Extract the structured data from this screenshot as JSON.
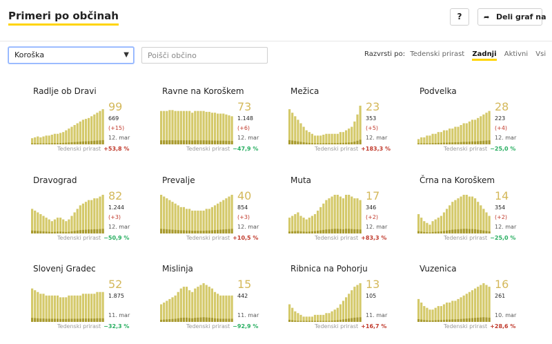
{
  "header": {
    "title": "Primeri po občinah",
    "help_label": "?",
    "share_label": "Deli graf na"
  },
  "filters": {
    "region": "Koroška",
    "search_placeholder": "Poišči občino",
    "sort_label": "Razvrsti po:",
    "sort_options": [
      "Tedenski prirast",
      "Zadnji",
      "Aktivni",
      "Vsi"
    ],
    "sort_active": "Zadnji"
  },
  "colors": {
    "accent": "#ffd400",
    "bar": "#d4c96a",
    "bar_dark": "#a89a2e",
    "positive_change": "#c0392b",
    "negative_change": "#27ae60"
  },
  "weekly_label": "Tedenski prirast",
  "cards": [
    {
      "name": "Radlje ob Dravi",
      "big": "99",
      "count": "669",
      "change": "(+15)",
      "date": "12. mar",
      "pct": "+53,8 %",
      "trend": "pos",
      "bars": [
        7,
        8,
        9,
        8,
        9,
        10,
        10,
        11,
        12,
        12,
        13,
        14,
        16,
        18,
        20,
        22,
        24,
        26,
        28,
        29,
        30,
        32,
        34,
        36,
        38,
        40
      ]
    },
    {
      "name": "Ravne na Koroškem",
      "big": "73",
      "count": "1.148",
      "change": "(+6)",
      "date": "12. mar",
      "pct": "−47,9 %",
      "trend": "neg",
      "bars": [
        38,
        38,
        38,
        39,
        39,
        38,
        38,
        38,
        38,
        38,
        38,
        36,
        38,
        38,
        38,
        38,
        37,
        37,
        36,
        36,
        35,
        35,
        35,
        34,
        33,
        32
      ]
    },
    {
      "name": "Mežica",
      "big": "23",
      "count": "353",
      "change": "(+5)",
      "date": "12. mar",
      "pct": "+183,3 %",
      "trend": "pos",
      "bars": [
        40,
        36,
        32,
        28,
        24,
        20,
        16,
        14,
        12,
        10,
        10,
        10,
        11,
        12,
        12,
        12,
        12,
        12,
        14,
        14,
        16,
        18,
        20,
        26,
        34,
        44
      ]
    },
    {
      "name": "Podvelka",
      "big": "28",
      "count": "223",
      "change": "(+4)",
      "date": "12. mar",
      "pct": "−25,0 %",
      "trend": "neg",
      "bars": [
        6,
        8,
        8,
        10,
        10,
        12,
        12,
        14,
        14,
        16,
        16,
        18,
        18,
        20,
        20,
        22,
        24,
        24,
        26,
        28,
        28,
        30,
        32,
        34,
        36,
        38
      ]
    },
    {
      "name": "Dravograd",
      "big": "82",
      "count": "1.244",
      "change": "(+3)",
      "date": "12. mar",
      "pct": "−50,9 %",
      "trend": "neg",
      "bars": [
        28,
        26,
        24,
        22,
        20,
        18,
        16,
        14,
        16,
        18,
        18,
        16,
        14,
        16,
        20,
        24,
        28,
        32,
        34,
        36,
        38,
        38,
        40,
        40,
        42,
        44
      ]
    },
    {
      "name": "Prevalje",
      "big": "40",
      "count": "854",
      "change": "(+3)",
      "date": "12. mar",
      "pct": "+10,5 %",
      "trend": "pos",
      "bars": [
        44,
        42,
        40,
        38,
        36,
        34,
        32,
        30,
        30,
        28,
        28,
        26,
        26,
        26,
        26,
        26,
        28,
        28,
        30,
        32,
        34,
        36,
        38,
        40,
        42,
        44
      ]
    },
    {
      "name": "Muta",
      "big": "17",
      "count": "346",
      "change": "(+2)",
      "date": "12. mar",
      "pct": "+83,3 %",
      "trend": "pos",
      "bars": [
        18,
        20,
        22,
        24,
        20,
        18,
        16,
        18,
        20,
        22,
        26,
        30,
        34,
        38,
        40,
        42,
        44,
        44,
        42,
        40,
        44,
        44,
        42,
        40,
        40,
        38
      ]
    },
    {
      "name": "Črna na Koroškem",
      "big": "14",
      "count": "354",
      "change": "(+2)",
      "date": "12. mar",
      "pct": "−25,0 %",
      "trend": "neg",
      "bars": [
        22,
        18,
        14,
        12,
        10,
        14,
        16,
        18,
        20,
        24,
        28,
        32,
        36,
        38,
        40,
        42,
        44,
        44,
        42,
        42,
        40,
        36,
        32,
        28,
        24,
        20
      ]
    },
    {
      "name": "Slovenj Gradec",
      "big": "52",
      "count": "1.875",
      "change": "",
      "date": "11. mar",
      "pct": "−32,3 %",
      "trend": "neg",
      "bars": [
        38,
        36,
        34,
        32,
        32,
        30,
        30,
        30,
        30,
        30,
        28,
        28,
        28,
        30,
        30,
        30,
        30,
        30,
        32,
        32,
        32,
        32,
        32,
        34,
        34,
        34
      ]
    },
    {
      "name": "Mislinja",
      "big": "15",
      "count": "442",
      "change": "",
      "date": "11. mar",
      "pct": "−92,9 %",
      "trend": "neg",
      "bars": [
        20,
        22,
        24,
        26,
        28,
        30,
        34,
        38,
        40,
        40,
        36,
        34,
        38,
        40,
        42,
        44,
        42,
        40,
        38,
        34,
        32,
        30,
        30,
        30,
        30,
        30
      ]
    },
    {
      "name": "Ribnica na Pohorju",
      "big": "13",
      "count": "105",
      "change": "",
      "date": "11. mar",
      "pct": "+16,7 %",
      "trend": "pos",
      "bars": [
        20,
        16,
        12,
        10,
        8,
        6,
        6,
        6,
        6,
        8,
        8,
        8,
        8,
        10,
        10,
        12,
        14,
        16,
        20,
        24,
        28,
        32,
        36,
        40,
        42,
        44
      ]
    },
    {
      "name": "Vuzenica",
      "big": "16",
      "count": "261",
      "change": "",
      "date": "10. mar",
      "pct": "+28,6 %",
      "trend": "pos",
      "bars": [
        26,
        22,
        18,
        16,
        14,
        14,
        16,
        18,
        18,
        20,
        22,
        22,
        24,
        24,
        26,
        28,
        30,
        32,
        34,
        36,
        38,
        40,
        42,
        44,
        42,
        40
      ]
    }
  ]
}
